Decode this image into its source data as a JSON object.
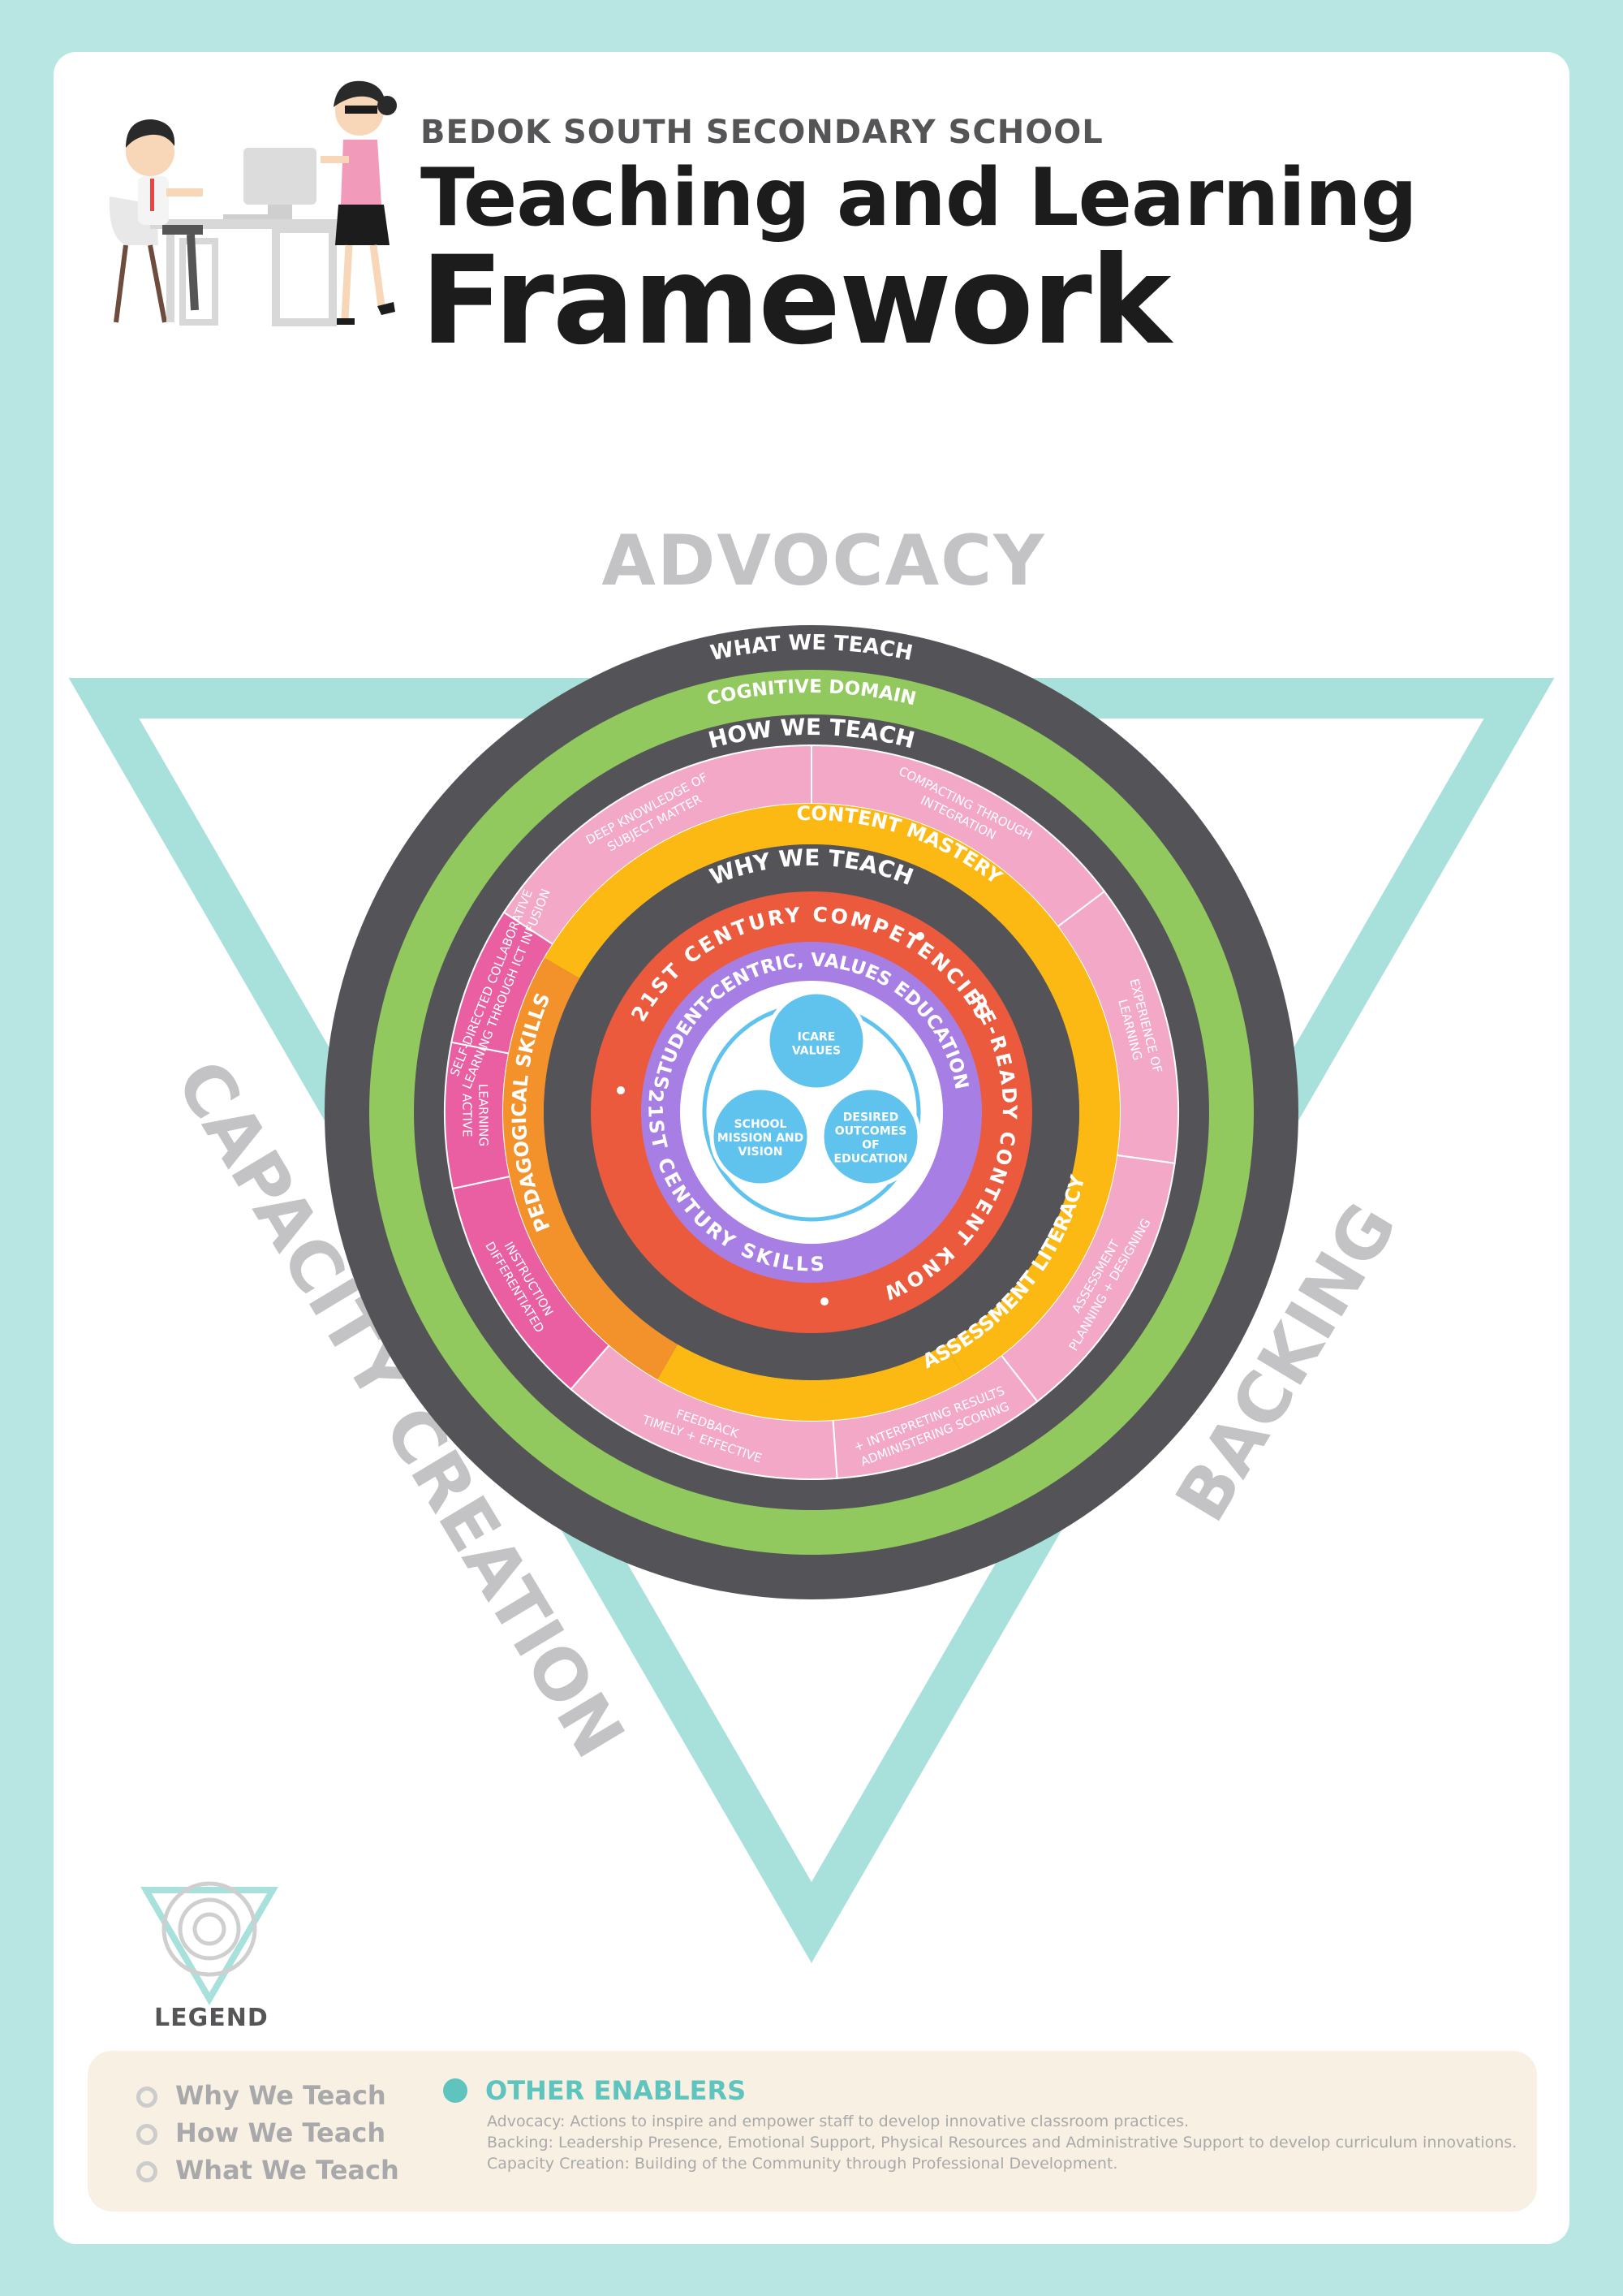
{
  "header": {
    "school": "BEDOK SOUTH SECONDARY SCHOOL",
    "title_line1": "Teaching and Learning",
    "title_line2": "Framework"
  },
  "enablers": {
    "top": "ADVOCACY",
    "left": "CAPACITY CREATION",
    "right": "BACKING"
  },
  "rings": {
    "what_we_teach": "WHAT WE TEACH",
    "cognitive_domain": "COGNITIVE DOMAIN",
    "how_we_teach": "HOW WE TEACH",
    "pedagogy_segments": [
      "DEEP KNOWLEDGE OF|SUBJECT MATTER",
      "COMPACTING THROUGH|INTEGRATION",
      "EXPERIENCE OF|LEARNING",
      "PLANNING + DESIGNING|ASSESSMENT",
      "ADMINISTERING SCORING|+ INTERPRETING RESULTS",
      "TIMELY + EFFECTIVE|FEEDBACK",
      "DIFFERENTIATED|INSTRUCTION",
      "ACTIVE|LEARNING",
      "SELF-DIRECTED COLLABORATIVE|LEARNING THROUGH ICT INFUSION"
    ],
    "content_mastery": "CONTENT MASTERY",
    "assessment_literacy": "ASSESSMENT LITERACY",
    "pedagogical_skills": "PEDAGOGICAL SKILLS",
    "why_we_teach": "WHY WE TEACH",
    "competencies": "21ST CENTURY COMPETENCIES",
    "future_ready": "FUTURE-READY CONTENT KNOWLEDG",
    "skills": "21ST CENTURY SKILLS",
    "values_education": "STUDENT-CENTRIC, VALUES EDUCATION",
    "core": {
      "icare": "ICARE|VALUES",
      "mission": "SCHOOL|MISSION AND|VISION",
      "outcomes": "DESIRED|OUTCOMES|OF|EDUCATION"
    }
  },
  "legend": {
    "label": "LEGEND",
    "items": [
      "Why We Teach",
      "How We Teach",
      "What We Teach"
    ],
    "other_title": "OTHER ENABLERS",
    "other_lines": [
      "Advocacy: Actions to inspire and empower staff to develop innovative classroom practices.",
      "Backing: Leadership Presence, Emotional Support, Physical Resources and Administrative Support to develop curriculum innovations.",
      "Capacity Creation: Building of the Community through Professional Development."
    ]
  },
  "colors": {
    "background": "#b8e6e3",
    "triangle": "#a8e0dc",
    "dark_ring": "#545458",
    "green_ring": "#92c95f",
    "pink_light": "#f4a8c7",
    "pink_dark": "#ea5fa2",
    "yellow": "#fdb913",
    "orange": "#f3922a",
    "red": "#ec5a3d",
    "purple": "#a77fe4",
    "blue": "#5fc3ee"
  }
}
